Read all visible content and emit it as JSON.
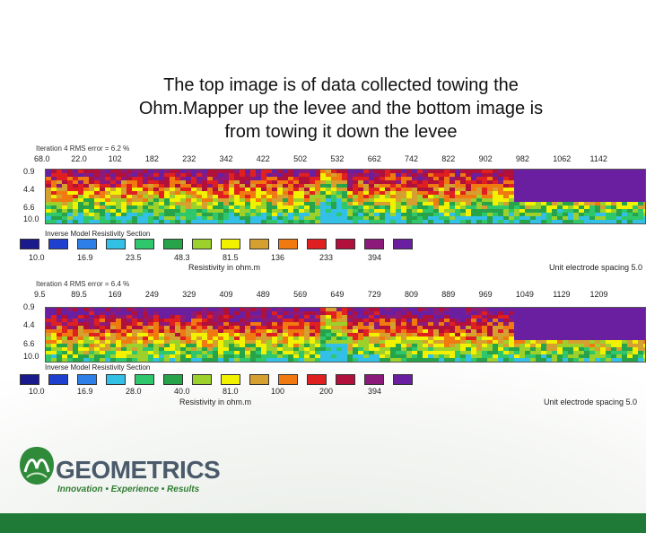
{
  "title_lines": [
    "The top image is of data collected towing the",
    "Ohm.Mapper up the levee and the bottom image is",
    "from towing it down the levee"
  ],
  "top_section": {
    "iteration_text": "Iteration 4 RMS error = 6.2 %",
    "x_ticks": [
      "68.0",
      "22.0",
      "102",
      "182",
      "232",
      "342",
      "422",
      "502",
      "532",
      "662",
      "742",
      "822",
      "902",
      "982",
      "1062",
      "1142"
    ],
    "depths": [
      "0.9",
      "4.4",
      "6.6",
      "10.0"
    ],
    "legend_title": "Inverse Model Resistivity Section",
    "legend_values": [
      "10.0",
      "16.9",
      "23.5",
      "48.3",
      "81.5",
      "136",
      "233",
      "394"
    ],
    "unit_label": "Resistivity in ohm.m",
    "spacing_label": "Unit electrode spacing 5.0"
  },
  "bottom_section": {
    "iteration_text": "Iteration 4 RMS error = 6.4 %",
    "x_ticks": [
      "9.5",
      "89.5",
      "169",
      "249",
      "329",
      "409",
      "489",
      "569",
      "649",
      "729",
      "809",
      "889",
      "969",
      "1049",
      "1129",
      "1209"
    ],
    "depths": [
      "0.9",
      "4.4",
      "6.6",
      "10.0"
    ],
    "legend_title": "Inverse Model Resistivity Section",
    "legend_values": [
      "10.0",
      "16.9",
      "28.0",
      "40.0",
      "81.0",
      "100",
      "200",
      "394"
    ],
    "unit_label": "Resistivity in ohm.m",
    "spacing_label": "Unit electrode spacing 5.0"
  },
  "legend_colors": [
    "#1a1a8c",
    "#1f3fcf",
    "#2e7fe8",
    "#33c0e6",
    "#2ec76b",
    "#27a34a",
    "#9bd12a",
    "#f2f200",
    "#d6a030",
    "#f07a10",
    "#e02020",
    "#b0103a",
    "#8c1a7a",
    "#6a1fa0"
  ],
  "logo": {
    "company": "GEOMETRICS",
    "tagline": "Innovation • Experience • Results",
    "brand_green": "#1e7a36"
  },
  "icons": [
    "geometrics-logo-icon"
  ]
}
